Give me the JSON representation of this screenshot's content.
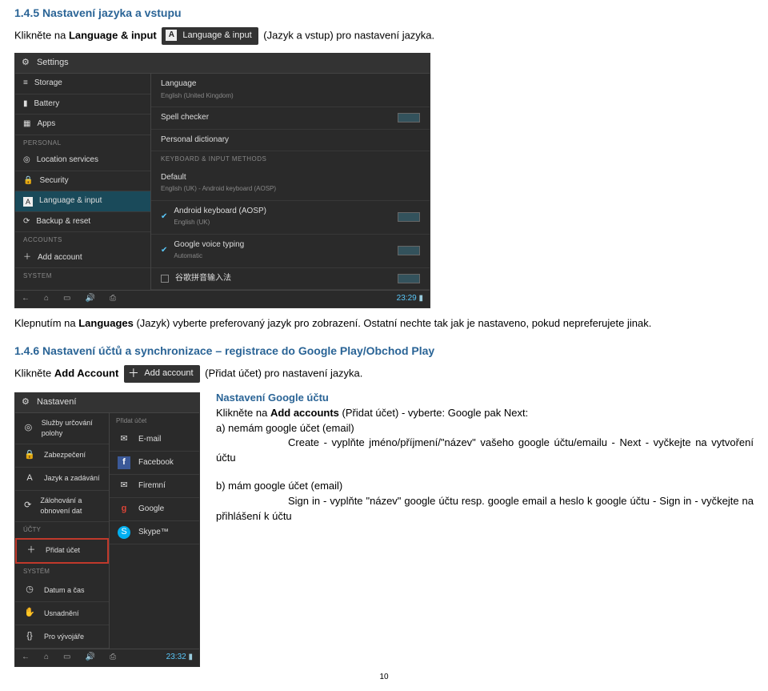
{
  "section145": {
    "title": "1.4.5 Nastavení jazyka a vstupu",
    "line1_a": "Klikněte na ",
    "line1_bold": "Language & input",
    "badge": "Language & input",
    "line1_b": " (Jazyk a vstup) pro nastavení jazyka."
  },
  "screenshot": {
    "title": "Settings",
    "left": {
      "items": [
        "Storage",
        "Battery",
        "Apps"
      ],
      "header_personal": "PERSONAL",
      "personal": [
        "Location services",
        "Security",
        "Language & input",
        "Backup & reset"
      ],
      "header_accounts": "ACCOUNTS",
      "accounts": [
        "Add account"
      ],
      "header_system": "SYSTEM"
    },
    "right": {
      "language": "Language",
      "language_sub": "English (United Kingdom)",
      "spell": "Spell checker",
      "dict": "Personal dictionary",
      "header_kb": "KEYBOARD & INPUT METHODS",
      "default": "Default",
      "default_sub": "English (UK) - Android keyboard (AOSP)",
      "akb": "Android keyboard (AOSP)",
      "akb_sub": "English (UK)",
      "gvt": "Google voice typing",
      "gvt_sub": "Automatic",
      "cn": "谷歌拼音输入法"
    },
    "time": "23:29"
  },
  "para2_a": "Klepnutím na ",
  "para2_bold": "Languages",
  "para2_b": " (Jazyk) vyberte preferovaný jazyk pro zobrazení. Ostatní nechte tak jak je nastaveno, pokud nepreferujete jinak.",
  "section146": {
    "title": "1.4.6 Nastavení účtů a synchronizace – registrace do Google Play/Obchod Play",
    "line1_a": "Klikněte ",
    "line1_bold": "Add Account",
    "badge": "Add account",
    "line1_b": " (Přidat účet) pro nastavení jazyka."
  },
  "screenshot2": {
    "title": "Nastavení",
    "items_top": [
      "Služby určování polohy",
      "Zabezpečení",
      "Jazyk a zadávání",
      "Zálohování a obnovení dat"
    ],
    "header_accounts": "ÚČTY",
    "add": "Přidat účet",
    "header_system": "SYSTÉM",
    "items_sys": [
      "Datum a čas",
      "Usnadnění",
      "Pro vývojáře"
    ],
    "accounts_panel": [
      "E-mail",
      "Facebook",
      "Firemní",
      "Google",
      "Skype™"
    ],
    "time": "23:32"
  },
  "google": {
    "title": "Nastavení Google účtu",
    "line1_a": "Klikněte na ",
    "line1_bold": "Add accounts",
    "line1_b": " (Přidat účet) - vyberte: Google pak Next:",
    "a_label": "a) nemám google účet (email)",
    "a_create": "Create - vyplňte jméno/příjmení/\"název\" vašeho google účtu/emailu - Next - vyčkejte na vytvoření účtu",
    "b_label": "b) mám google účet (email)",
    "b_signin": "Sign in - vyplňte \"název\" google účtu resp. google email a heslo k google účtu - Sign in - vyčkejte na přihlášení k účtu"
  },
  "page": "10"
}
